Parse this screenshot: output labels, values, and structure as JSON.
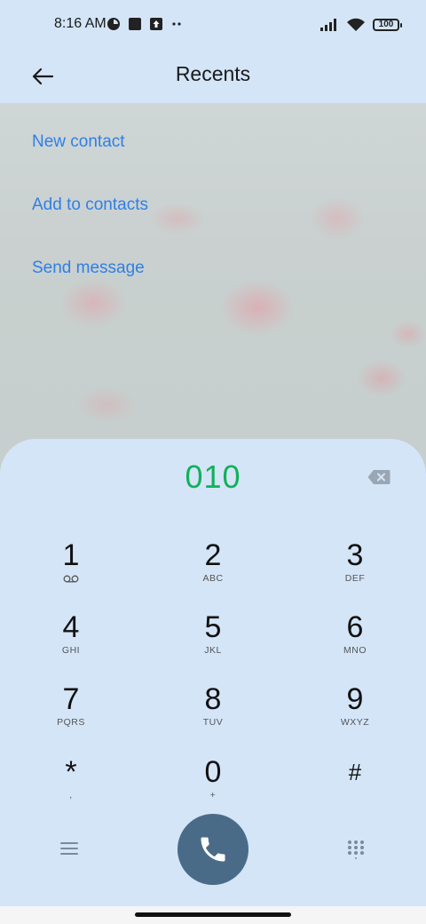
{
  "status_bar": {
    "time": "8:16 AM",
    "battery": "100",
    "icons": [
      "app-notification-icon",
      "square-notification-icon",
      "upload-notification-icon",
      "more-dots-icon",
      "signal-icon",
      "wifi-icon",
      "battery-icon"
    ]
  },
  "header": {
    "title": "Recents"
  },
  "actions": {
    "new_contact": "New contact",
    "add_to_contacts": "Add to contacts",
    "send_message": "Send message"
  },
  "dialpad": {
    "number": "010",
    "keys": [
      {
        "digit": "1",
        "letters": ""
      },
      {
        "digit": "2",
        "letters": "ABC"
      },
      {
        "digit": "3",
        "letters": "DEF"
      },
      {
        "digit": "4",
        "letters": "GHI"
      },
      {
        "digit": "5",
        "letters": "JKL"
      },
      {
        "digit": "6",
        "letters": "MNO"
      },
      {
        "digit": "7",
        "letters": "PQRS"
      },
      {
        "digit": "8",
        "letters": "TUV"
      },
      {
        "digit": "9",
        "letters": "WXYZ"
      },
      {
        "digit": "*",
        "letters": ","
      },
      {
        "digit": "0",
        "letters": "+"
      },
      {
        "digit": "#",
        "letters": ""
      }
    ]
  },
  "colors": {
    "accent_link": "#2f7fe6",
    "dialed_number": "#13b05a",
    "call_button": "#4a6b88",
    "background": "#d4e5f8"
  }
}
